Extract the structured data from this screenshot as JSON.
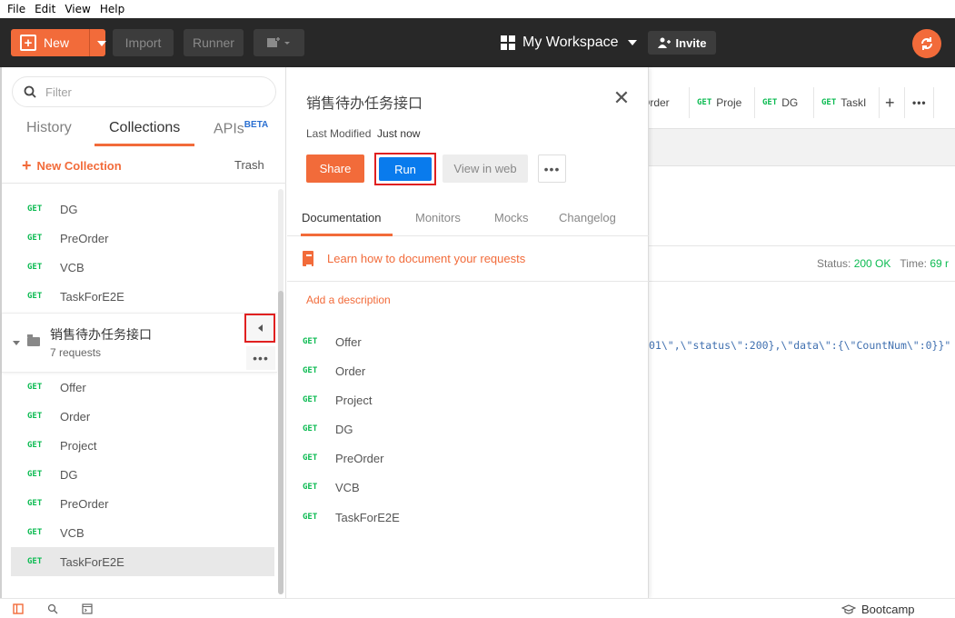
{
  "menu": [
    "File",
    "Edit",
    "View",
    "Help"
  ],
  "header": {
    "new_label": "New",
    "import_label": "Import",
    "runner_label": "Runner",
    "workspace_label": "My Workspace",
    "invite_label": "Invite"
  },
  "sidebar": {
    "filter_placeholder": "Filter",
    "tabs": [
      "History",
      "Collections",
      "APIs"
    ],
    "beta": "BETA",
    "new_collection": "New Collection",
    "trash": "Trash",
    "requests_above": [
      {
        "method": "GET",
        "name": "DG"
      },
      {
        "method": "GET",
        "name": "PreOrder"
      },
      {
        "method": "GET",
        "name": "VCB"
      },
      {
        "method": "GET",
        "name": "TaskForE2E"
      }
    ],
    "folder": {
      "name": "销售待办任务接口",
      "count": "7 requests"
    },
    "requests": [
      {
        "method": "GET",
        "name": "Offer"
      },
      {
        "method": "GET",
        "name": "Order"
      },
      {
        "method": "GET",
        "name": "Project"
      },
      {
        "method": "GET",
        "name": "DG"
      },
      {
        "method": "GET",
        "name": "PreOrder"
      },
      {
        "method": "GET",
        "name": "VCB"
      },
      {
        "method": "GET",
        "name": "TaskForE2E"
      }
    ]
  },
  "panel": {
    "title": "销售待办任务接口",
    "last_modified_label": "Last Modified",
    "last_modified_value": "Just now",
    "share": "Share",
    "run": "Run",
    "view_in_web": "View in web",
    "tabs": [
      "Documentation",
      "Monitors",
      "Mocks",
      "Changelog"
    ],
    "learn": "Learn how to document your requests",
    "add_description": "Add a description",
    "requests": [
      {
        "method": "GET",
        "name": "Offer"
      },
      {
        "method": "GET",
        "name": "Order"
      },
      {
        "method": "GET",
        "name": "Project"
      },
      {
        "method": "GET",
        "name": "DG"
      },
      {
        "method": "GET",
        "name": "PreOrder"
      },
      {
        "method": "GET",
        "name": "VCB"
      },
      {
        "method": "GET",
        "name": "TaskForE2E"
      }
    ]
  },
  "background": {
    "tabs": [
      {
        "method": "",
        "name": "Order"
      },
      {
        "method": "GET",
        "name": "Proje"
      },
      {
        "method": "GET",
        "name": "DG"
      },
      {
        "method": "GET",
        "name": "TaskI"
      }
    ],
    "status_label": "Status:",
    "status_value": "200 OK",
    "time_label": "Time:",
    "time_value": "69 r",
    "json_snippet": "01\\\",\\\"status\\\":200},\\\"data\\\":{\\\"CountNum\\\":0}}\""
  },
  "footer": {
    "bootcamp": "Bootcamp"
  },
  "colors": {
    "accent": "#f26b3a",
    "run_blue": "#097bed",
    "get_green": "#0cbb52",
    "header_bg": "#282828"
  }
}
